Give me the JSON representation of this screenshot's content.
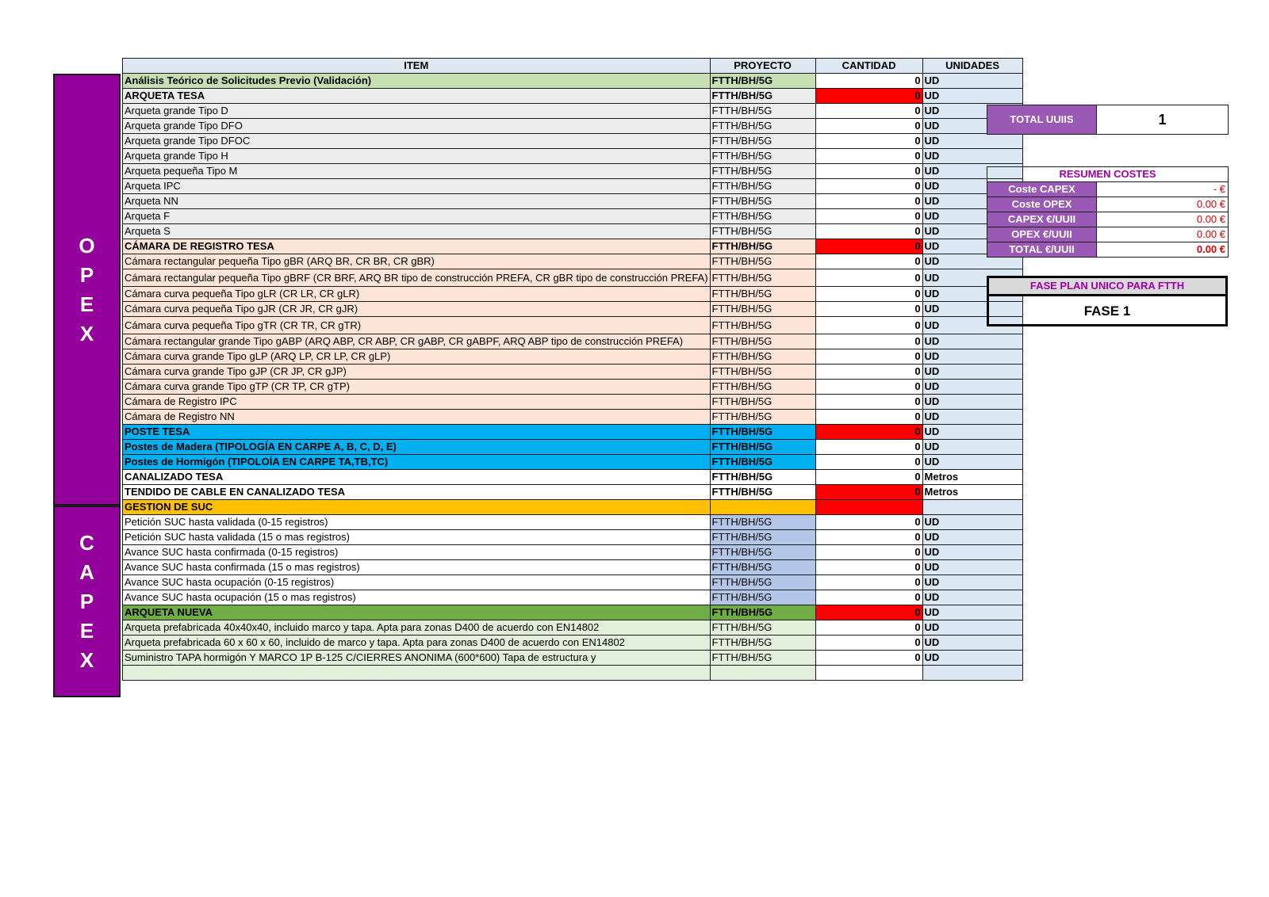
{
  "headers": [
    "ITEM",
    "PROYECTO",
    "CANTIDAD",
    "UNIDADES"
  ],
  "side_labels": {
    "opex": [
      "O",
      "P",
      "E",
      "X"
    ],
    "capex": [
      "C",
      "A",
      "P",
      "E",
      "X"
    ]
  },
  "rows": [
    {
      "item": "Análisis Teórico de Solicitudes Previo (Validación)",
      "proyecto": "FTTH/BH/5G",
      "cantidad": "0",
      "unidades": "UD",
      "bold": true,
      "bg": "#c6e0b4",
      "projbg": "#c6e0b4",
      "red": false
    },
    {
      "item": "ARQUETA TESA",
      "proyecto": "FTTH/BH/5G",
      "cantidad": "0",
      "unidades": "UD",
      "bold": true,
      "bg": "#ededed",
      "projbg": "#ededed",
      "red": true
    },
    {
      "item": "Arqueta grande Tipo D",
      "proyecto": "FTTH/BH/5G",
      "cantidad": "0",
      "unidades": "UD",
      "bold": false,
      "bg": "#ededed",
      "projbg": "#ededed",
      "red": false
    },
    {
      "item": "Arqueta grande Tipo DFO",
      "proyecto": "FTTH/BH/5G",
      "cantidad": "0",
      "unidades": "UD",
      "bold": false,
      "bg": "#ededed",
      "projbg": "#ededed",
      "red": false
    },
    {
      "item": "Arqueta grande Tipo DFOC",
      "proyecto": "FTTH/BH/5G",
      "cantidad": "0",
      "unidades": "UD",
      "bold": false,
      "bg": "#ededed",
      "projbg": "#ededed",
      "red": false
    },
    {
      "item": "Arqueta grande Tipo H",
      "proyecto": "FTTH/BH/5G",
      "cantidad": "0",
      "unidades": "UD",
      "bold": false,
      "bg": "#ededed",
      "projbg": "#ededed",
      "red": false
    },
    {
      "item": "Arqueta pequeña Tipo M",
      "proyecto": "FTTH/BH/5G",
      "cantidad": "0",
      "unidades": "UD",
      "bold": false,
      "bg": "#ededed",
      "projbg": "#ededed",
      "red": false
    },
    {
      "item": "Arqueta IPC",
      "proyecto": "FTTH/BH/5G",
      "cantidad": "0",
      "unidades": "UD",
      "bold": false,
      "bg": "#ededed",
      "projbg": "#ededed",
      "red": false
    },
    {
      "item": "Arqueta NN",
      "proyecto": "FTTH/BH/5G",
      "cantidad": "0",
      "unidades": "UD",
      "bold": false,
      "bg": "#ededed",
      "projbg": "#ededed",
      "red": false
    },
    {
      "item": "Arqueta F",
      "proyecto": "FTTH/BH/5G",
      "cantidad": "0",
      "unidades": "UD",
      "bold": false,
      "bg": "#ededed",
      "projbg": "#ededed",
      "red": false
    },
    {
      "item": "Arqueta S",
      "proyecto": "FTTH/BH/5G",
      "cantidad": "0",
      "unidades": "UD",
      "bold": false,
      "bg": "#ededed",
      "projbg": "#ededed",
      "red": false
    },
    {
      "item": "CÁMARA DE REGISTRO TESA",
      "proyecto": "FTTH/BH/5G",
      "cantidad": "0",
      "unidades": "UD",
      "bold": true,
      "bg": "#fce4d6",
      "projbg": "#fce4d6",
      "red": true
    },
    {
      "item": "Cámara rectangular pequeña Tipo gBR (ARQ BR, CR BR, CR gBR)",
      "proyecto": "FTTH/BH/5G",
      "cantidad": "0",
      "unidades": "UD",
      "bold": false,
      "bg": "#fce4d6",
      "projbg": "#fce4d6",
      "red": false
    },
    {
      "item": "Cámara rectangular pequeña Tipo gBRF (CR BRF, ARQ BR tipo de construcción PREFA, CR gBR tipo de construcción PREFA)",
      "proyecto": "FTTH/BH/5G",
      "cantidad": "0",
      "unidades": "UD",
      "bold": false,
      "bg": "#fce4d6",
      "projbg": "#fce4d6",
      "red": false,
      "tall": true
    },
    {
      "item": "Cámara curva pequeña Tipo gLR (CR LR, CR gLR)",
      "proyecto": "FTTH/BH/5G",
      "cantidad": "0",
      "unidades": "UD",
      "bold": false,
      "bg": "#fce4d6",
      "projbg": "#fce4d6",
      "red": false
    },
    {
      "item": "Cámara curva pequeña Tipo gJR (CR JR, CR gJR)",
      "proyecto": "FTTH/BH/5G",
      "cantidad": "0",
      "unidades": "UD",
      "bold": false,
      "bg": "#fce4d6",
      "projbg": "#fce4d6",
      "red": false
    },
    {
      "item": "Cámara curva pequeña Tipo gTR (CR TR, CR gTR)",
      "proyecto": "FTTH/BH/5G",
      "cantidad": "0",
      "unidades": "UD",
      "bold": false,
      "bg": "#fce4d6",
      "projbg": "#fce4d6",
      "red": false,
      "tall": true
    },
    {
      "item": "Cámara rectangular grande Tipo gABP (ARQ ABP, CR ABP, CR gABP, CR gABPF, ARQ ABP tipo de construcción PREFA)",
      "proyecto": "FTTH/BH/5G",
      "cantidad": "0",
      "unidades": "UD",
      "bold": false,
      "bg": "#fce4d6",
      "projbg": "#fce4d6",
      "red": false
    },
    {
      "item": "Cámara curva grande Tipo gLP (ARQ LP, CR LP, CR gLP)",
      "proyecto": "FTTH/BH/5G",
      "cantidad": "0",
      "unidades": "UD",
      "bold": false,
      "bg": "#fce4d6",
      "projbg": "#fce4d6",
      "red": false
    },
    {
      "item": "Cámara curva grande Tipo gJP (CR JP, CR gJP)",
      "proyecto": "FTTH/BH/5G",
      "cantidad": "0",
      "unidades": "UD",
      "bold": false,
      "bg": "#fce4d6",
      "projbg": "#fce4d6",
      "red": false
    },
    {
      "item": "Cámara curva grande Tipo gTP (CR TP, CR gTP)",
      "proyecto": "FTTH/BH/5G",
      "cantidad": "0",
      "unidades": "UD",
      "bold": false,
      "bg": "#fce4d6",
      "projbg": "#fce4d6",
      "red": false
    },
    {
      "item": "Cámara de Registro IPC",
      "proyecto": "FTTH/BH/5G",
      "cantidad": "0",
      "unidades": "UD",
      "bold": false,
      "bg": "#fce4d6",
      "projbg": "#fce4d6",
      "red": false
    },
    {
      "item": "Cámara de Registro NN",
      "proyecto": "FTTH/BH/5G",
      "cantidad": "0",
      "unidades": "UD",
      "bold": false,
      "bg": "#fce4d6",
      "projbg": "#fce4d6",
      "red": false
    },
    {
      "item": "POSTE TESA",
      "proyecto": "FTTH/BH/5G",
      "cantidad": "0",
      "unidades": "UD",
      "bold": true,
      "bg": "#00b0f0",
      "projbg": "#00b0f0",
      "red": true
    },
    {
      "item": "Postes de Madera (TIPOLOGÍA EN CARPE A, B, C, D, E)",
      "proyecto": "FTTH/BH/5G",
      "cantidad": "0",
      "unidades": "UD",
      "bold": true,
      "bg": "#00b0f0",
      "projbg": "#00b0f0",
      "red": false
    },
    {
      "item": "Postes de Hormigón (TIPOLOÍA EN CARPE TA,TB,TC)",
      "proyecto": "FTTH/BH/5G",
      "cantidad": "0",
      "unidades": "UD",
      "bold": true,
      "bg": "#00b0f0",
      "projbg": "#00b0f0",
      "red": false
    },
    {
      "item": "CANALIZADO TESA",
      "proyecto": "FTTH/BH/5G",
      "cantidad": "0",
      "unidades": "Metros",
      "bold": true,
      "bg": "#ffffff",
      "projbg": "#ffffff",
      "red": false,
      "unitbg": "#ffffff"
    },
    {
      "item": "TENDIDO DE CABLE EN CANALIZADO TESA",
      "proyecto": "FTTH/BH/5G",
      "cantidad": "0",
      "unidades": "Metros",
      "bold": true,
      "bg": "#ffffff",
      "projbg": "#ffffff",
      "red": true,
      "unitbg": "#ffffff"
    },
    {
      "item": "GESTION DE SUC",
      "proyecto": "",
      "cantidad": "",
      "unidades": "",
      "bold": true,
      "bg": "#ffc000",
      "projbg": "#ffc000",
      "red": true
    },
    {
      "item": "Petición SUC hasta validada (0-15 registros)",
      "proyecto": "FTTH/BH/5G",
      "cantidad": "0",
      "unidades": "UD",
      "bold": false,
      "bg": "#ffffff",
      "projbg": "#b4c6e7",
      "red": false
    },
    {
      "item": "Petición SUC hasta validada (15 o mas registros)",
      "proyecto": "FTTH/BH/5G",
      "cantidad": "0",
      "unidades": "UD",
      "bold": false,
      "bg": "#ffffff",
      "projbg": "#b4c6e7",
      "red": false
    },
    {
      "item": "Avance SUC hasta confirmada (0-15 registros)",
      "proyecto": "FTTH/BH/5G",
      "cantidad": "0",
      "unidades": "UD",
      "bold": false,
      "bg": "#ffffff",
      "projbg": "#b4c6e7",
      "red": false
    },
    {
      "item": "Avance SUC hasta confirmada (15 o mas registros)",
      "proyecto": "FTTH/BH/5G",
      "cantidad": "0",
      "unidades": "UD",
      "bold": false,
      "bg": "#ffffff",
      "projbg": "#b4c6e7",
      "red": false
    },
    {
      "item": "Avance SUC hasta ocupación (0-15 registros)",
      "proyecto": "FTTH/BH/5G",
      "cantidad": "0",
      "unidades": "UD",
      "bold": false,
      "bg": "#ffffff",
      "projbg": "#b4c6e7",
      "red": false
    },
    {
      "item": "Avance SUC hasta ocupación (15 o mas registros)",
      "proyecto": "FTTH/BH/5G",
      "cantidad": "0",
      "unidades": "UD",
      "bold": false,
      "bg": "#ffffff",
      "projbg": "#b4c6e7",
      "red": false
    },
    {
      "item": "ARQUETA NUEVA",
      "proyecto": "FTTH/BH/5G",
      "cantidad": "0",
      "unidades": "UD",
      "bold": true,
      "bg": "#70ad47",
      "projbg": "#70ad47",
      "red": true
    },
    {
      "item": "Arqueta prefabricada 40x40x40, incluido marco y tapa. Apta para zonas D400 de acuerdo con EN14802",
      "proyecto": "FTTH/BH/5G",
      "cantidad": "0",
      "unidades": "UD",
      "bold": false,
      "bg": "#e2efda",
      "projbg": "#e2efda",
      "red": false
    },
    {
      "item": "Arqueta prefabricada 60 x 60 x 60, incluido de marco y tapa. Apta para zonas D400 de acuerdo con EN14802",
      "proyecto": "FTTH/BH/5G",
      "cantidad": "0",
      "unidades": "UD",
      "bold": false,
      "bg": "#e2efda",
      "projbg": "#e2efda",
      "red": false
    },
    {
      "item": "Suministro TAPA hormigón Y MARCO 1P B-125 C/CIERRES ANONIMA (600*600) Tapa de estructura y",
      "proyecto": "FTTH/BH/5G",
      "cantidad": "0",
      "unidades": "UD",
      "bold": false,
      "bg": "#e2efda",
      "projbg": "#e2efda",
      "red": false
    },
    {
      "item": "",
      "proyecto": "",
      "cantidad": "",
      "unidades": "",
      "bold": false,
      "bg": "#e2efda",
      "projbg": "#e2efda",
      "red": false
    }
  ],
  "total_uuiis": {
    "label": "TOTAL UUIIS",
    "value": "1"
  },
  "resumen": {
    "title": "RESUMEN COSTES",
    "rows": [
      {
        "label": "Coste CAPEX",
        "value": "-    €",
        "bold": false
      },
      {
        "label": "Coste OPEX",
        "value": "0.00 €",
        "bold": false
      },
      {
        "label": "CAPEX €/UUII",
        "value": "0.00 €",
        "bold": false
      },
      {
        "label": "OPEX €/UUII",
        "value": "0.00 €",
        "bold": false
      },
      {
        "label": "TOTAL €/UUII",
        "value": "0.00 €",
        "bold": true
      }
    ]
  },
  "fase": {
    "title": "FASE PLAN UNICO PARA FTTH",
    "value": "FASE 1"
  },
  "colors": {
    "purple": "#93009b",
    "red_cell": "#ff0000",
    "label_purple": "#9b59b6"
  }
}
